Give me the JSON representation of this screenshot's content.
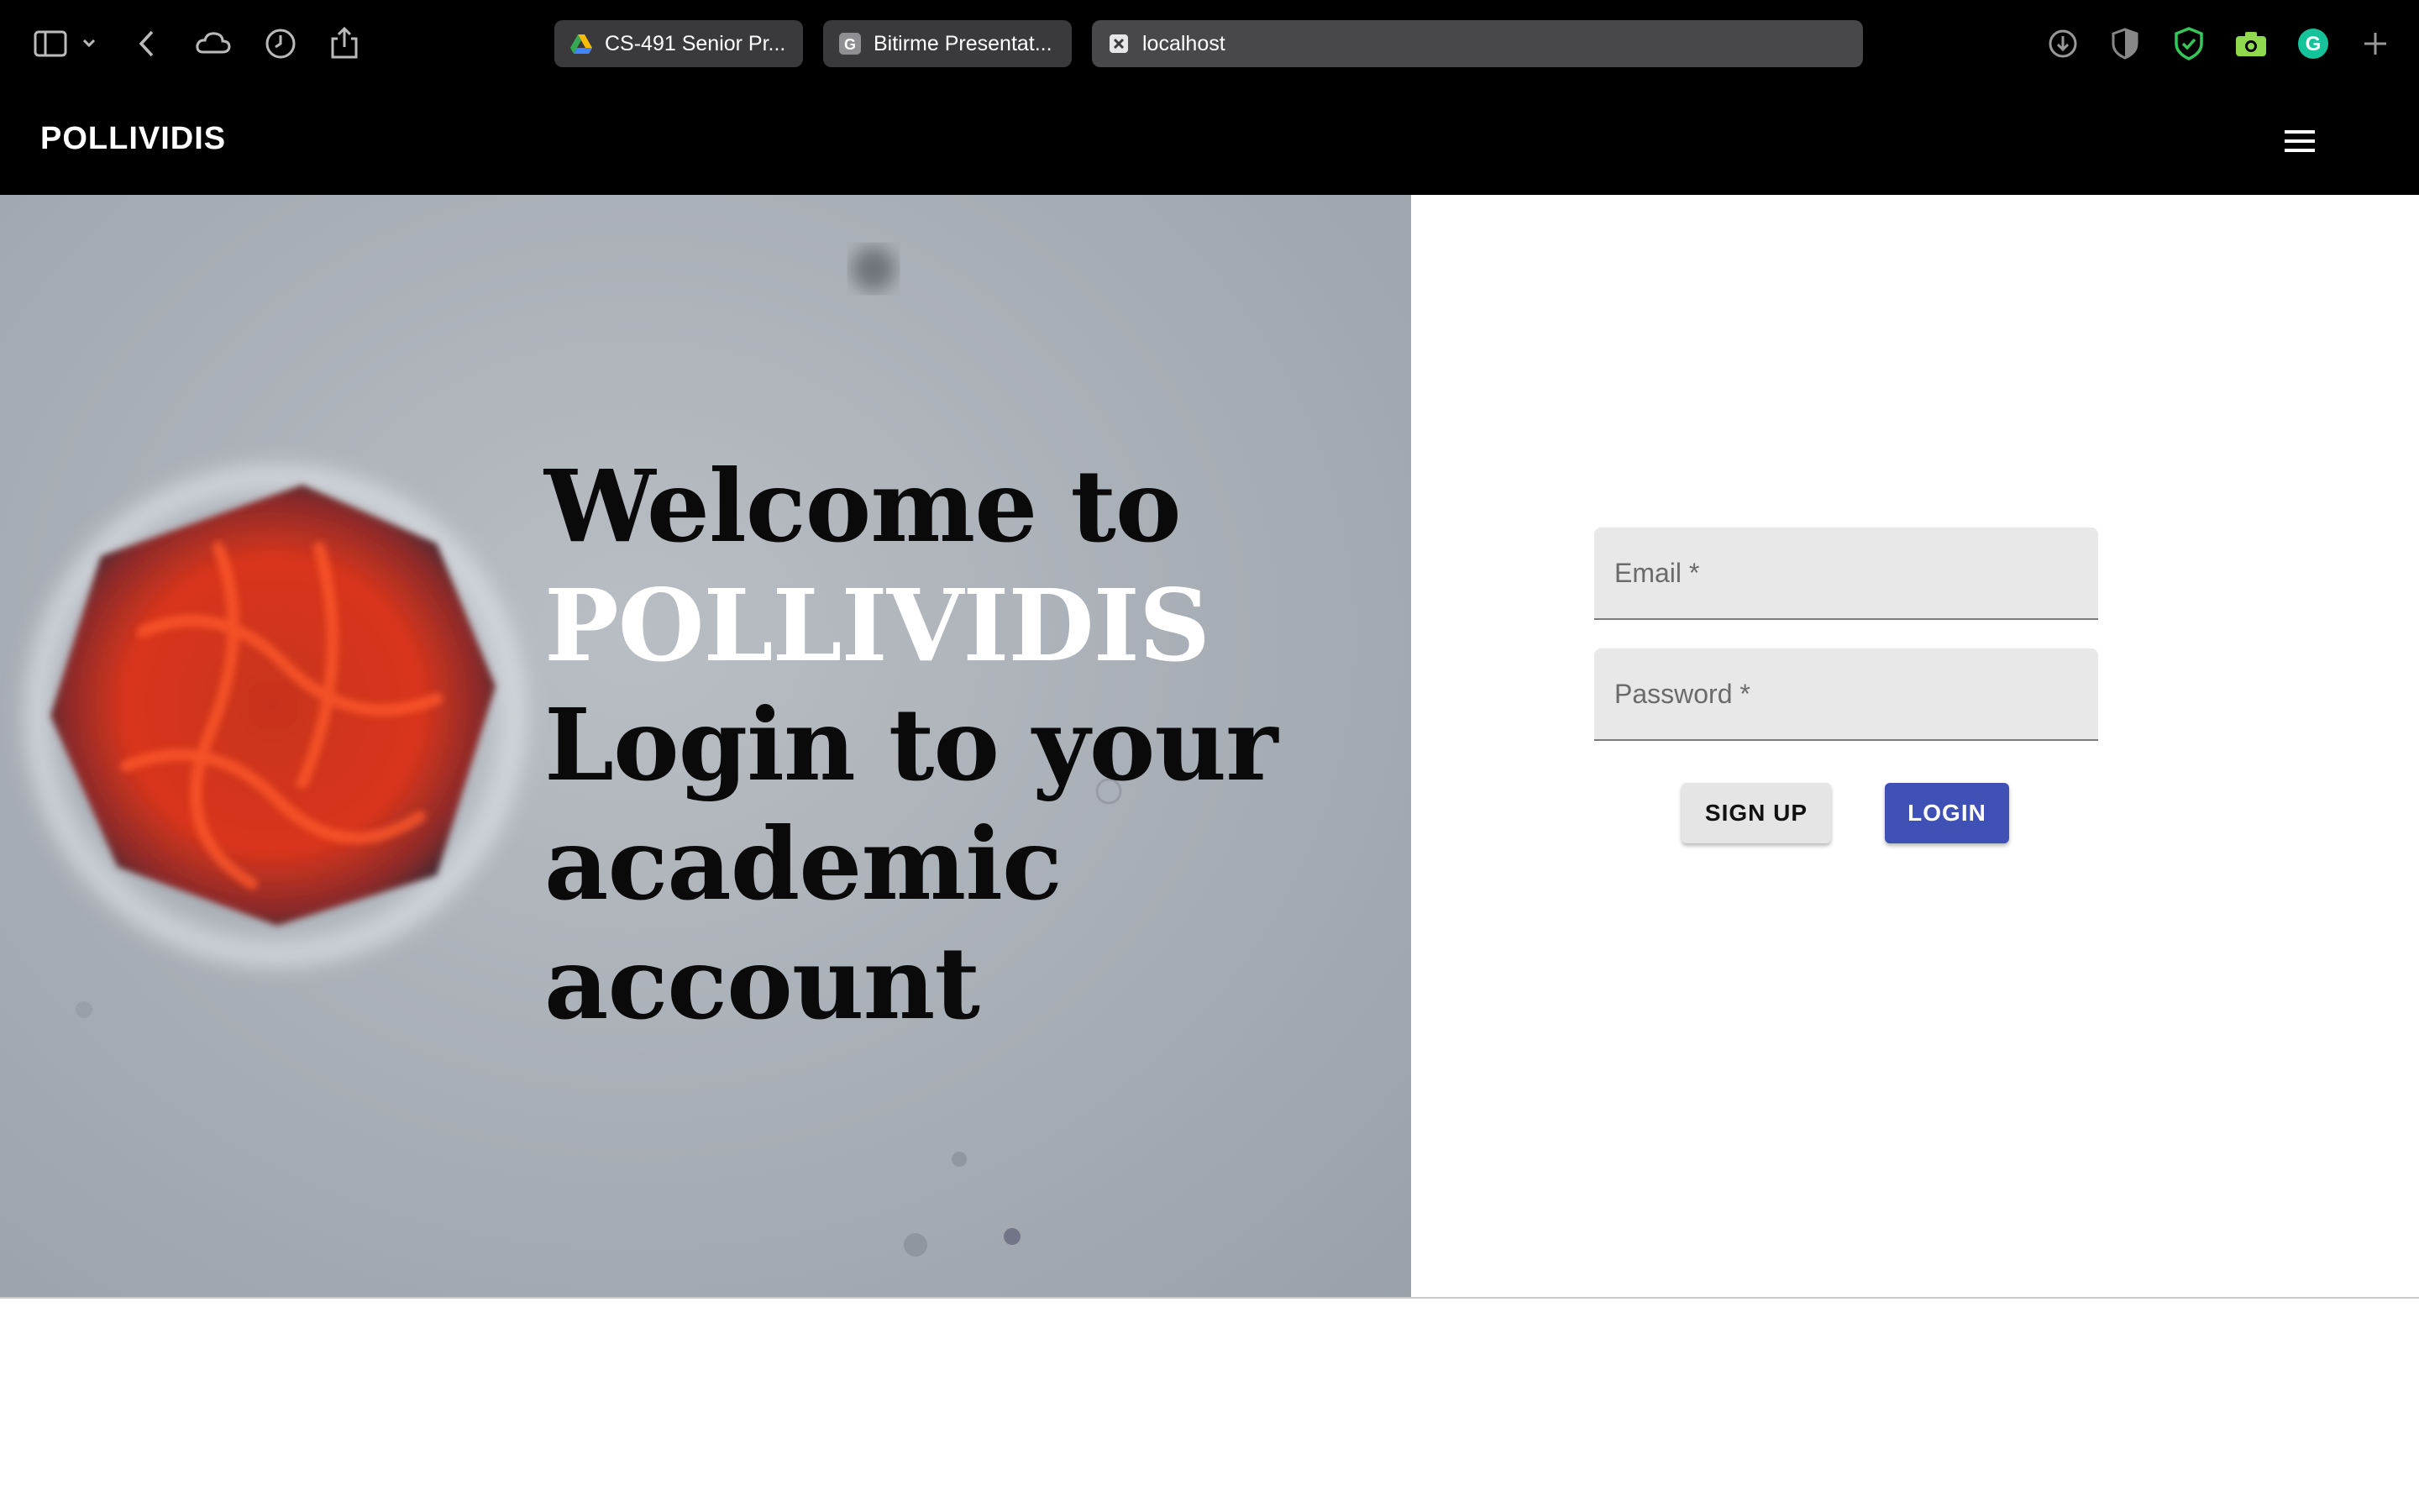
{
  "browser": {
    "tabs": [
      {
        "label": "CS-491 Senior Pr...",
        "icon": "google-drive-icon"
      },
      {
        "label": "Bitirme Presentat...",
        "icon": "google-slides-icon"
      },
      {
        "label": "localhost",
        "icon": "close-tab-icon"
      }
    ],
    "toolbar_icons": [
      "sidebar-icon",
      "chevron-down-icon",
      "back-icon",
      "icloud-icon",
      "history-icon",
      "share-icon",
      "download-icon",
      "privacy-shield-icon",
      "adblock-shield-icon",
      "camera-icon",
      "grammarly-icon",
      "new-tab-icon"
    ]
  },
  "app": {
    "brand": "POLLIVIDIS",
    "menu_icon": "hamburger-menu-icon"
  },
  "hero": {
    "line1": "Welcome to",
    "line2": "POLLIVIDIS",
    "line3": "Login to your",
    "line4": "academic account"
  },
  "login": {
    "email_placeholder": "Email *",
    "password_placeholder": "Password *",
    "signup_label": "SIGN UP",
    "login_label": "LOGIN"
  },
  "colors": {
    "appbar": "#000000",
    "login_button": "#3f51b5",
    "signup_button": "#e5e5e5",
    "field_bg": "#e8e8e8"
  }
}
